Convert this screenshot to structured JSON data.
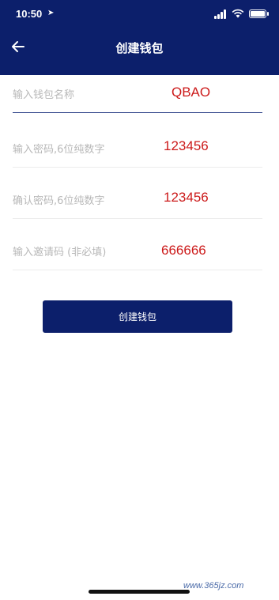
{
  "status_bar": {
    "time": "10:50"
  },
  "nav": {
    "title": "创建钱包"
  },
  "fields": [
    {
      "placeholder": "输入钱包名称",
      "annotation": "QBAO"
    },
    {
      "placeholder": "输入密码,6位纯数字",
      "annotation": "123456"
    },
    {
      "placeholder": "确认密码,6位纯数字",
      "annotation": "123456"
    },
    {
      "placeholder": "输入邀请码 (非必填)",
      "annotation": "666666"
    }
  ],
  "button": {
    "label": "创建钱包"
  },
  "watermark": {
    "text": "www.365jz.com"
  },
  "colors": {
    "primary": "#0c1f6b",
    "annotation": "#cc1a1a",
    "active_underline": "#2a3f86"
  },
  "icons": {
    "back": "arrow-left-icon",
    "location": "location-arrow-icon",
    "signal": "cellular-signal-icon",
    "wifi": "wifi-icon",
    "battery": "battery-icon"
  }
}
